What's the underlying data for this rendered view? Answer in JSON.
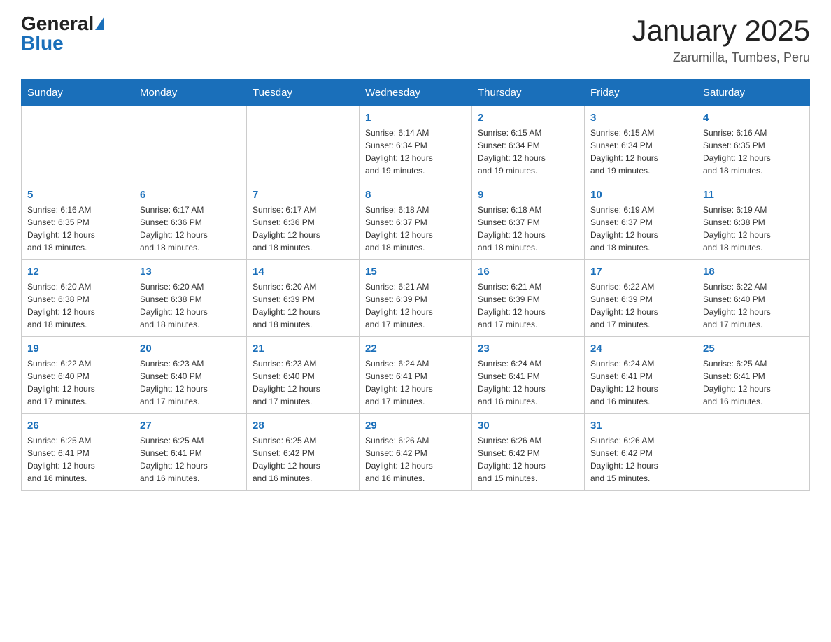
{
  "header": {
    "logo_text_general": "General",
    "logo_text_blue": "Blue",
    "title": "January 2025",
    "subtitle": "Zarumilla, Tumbes, Peru"
  },
  "days_of_week": [
    "Sunday",
    "Monday",
    "Tuesday",
    "Wednesday",
    "Thursday",
    "Friday",
    "Saturday"
  ],
  "weeks": [
    [
      {
        "day": "",
        "info": ""
      },
      {
        "day": "",
        "info": ""
      },
      {
        "day": "",
        "info": ""
      },
      {
        "day": "1",
        "info": "Sunrise: 6:14 AM\nSunset: 6:34 PM\nDaylight: 12 hours\nand 19 minutes."
      },
      {
        "day": "2",
        "info": "Sunrise: 6:15 AM\nSunset: 6:34 PM\nDaylight: 12 hours\nand 19 minutes."
      },
      {
        "day": "3",
        "info": "Sunrise: 6:15 AM\nSunset: 6:34 PM\nDaylight: 12 hours\nand 19 minutes."
      },
      {
        "day": "4",
        "info": "Sunrise: 6:16 AM\nSunset: 6:35 PM\nDaylight: 12 hours\nand 18 minutes."
      }
    ],
    [
      {
        "day": "5",
        "info": "Sunrise: 6:16 AM\nSunset: 6:35 PM\nDaylight: 12 hours\nand 18 minutes."
      },
      {
        "day": "6",
        "info": "Sunrise: 6:17 AM\nSunset: 6:36 PM\nDaylight: 12 hours\nand 18 minutes."
      },
      {
        "day": "7",
        "info": "Sunrise: 6:17 AM\nSunset: 6:36 PM\nDaylight: 12 hours\nand 18 minutes."
      },
      {
        "day": "8",
        "info": "Sunrise: 6:18 AM\nSunset: 6:37 PM\nDaylight: 12 hours\nand 18 minutes."
      },
      {
        "day": "9",
        "info": "Sunrise: 6:18 AM\nSunset: 6:37 PM\nDaylight: 12 hours\nand 18 minutes."
      },
      {
        "day": "10",
        "info": "Sunrise: 6:19 AM\nSunset: 6:37 PM\nDaylight: 12 hours\nand 18 minutes."
      },
      {
        "day": "11",
        "info": "Sunrise: 6:19 AM\nSunset: 6:38 PM\nDaylight: 12 hours\nand 18 minutes."
      }
    ],
    [
      {
        "day": "12",
        "info": "Sunrise: 6:20 AM\nSunset: 6:38 PM\nDaylight: 12 hours\nand 18 minutes."
      },
      {
        "day": "13",
        "info": "Sunrise: 6:20 AM\nSunset: 6:38 PM\nDaylight: 12 hours\nand 18 minutes."
      },
      {
        "day": "14",
        "info": "Sunrise: 6:20 AM\nSunset: 6:39 PM\nDaylight: 12 hours\nand 18 minutes."
      },
      {
        "day": "15",
        "info": "Sunrise: 6:21 AM\nSunset: 6:39 PM\nDaylight: 12 hours\nand 17 minutes."
      },
      {
        "day": "16",
        "info": "Sunrise: 6:21 AM\nSunset: 6:39 PM\nDaylight: 12 hours\nand 17 minutes."
      },
      {
        "day": "17",
        "info": "Sunrise: 6:22 AM\nSunset: 6:39 PM\nDaylight: 12 hours\nand 17 minutes."
      },
      {
        "day": "18",
        "info": "Sunrise: 6:22 AM\nSunset: 6:40 PM\nDaylight: 12 hours\nand 17 minutes."
      }
    ],
    [
      {
        "day": "19",
        "info": "Sunrise: 6:22 AM\nSunset: 6:40 PM\nDaylight: 12 hours\nand 17 minutes."
      },
      {
        "day": "20",
        "info": "Sunrise: 6:23 AM\nSunset: 6:40 PM\nDaylight: 12 hours\nand 17 minutes."
      },
      {
        "day": "21",
        "info": "Sunrise: 6:23 AM\nSunset: 6:40 PM\nDaylight: 12 hours\nand 17 minutes."
      },
      {
        "day": "22",
        "info": "Sunrise: 6:24 AM\nSunset: 6:41 PM\nDaylight: 12 hours\nand 17 minutes."
      },
      {
        "day": "23",
        "info": "Sunrise: 6:24 AM\nSunset: 6:41 PM\nDaylight: 12 hours\nand 16 minutes."
      },
      {
        "day": "24",
        "info": "Sunrise: 6:24 AM\nSunset: 6:41 PM\nDaylight: 12 hours\nand 16 minutes."
      },
      {
        "day": "25",
        "info": "Sunrise: 6:25 AM\nSunset: 6:41 PM\nDaylight: 12 hours\nand 16 minutes."
      }
    ],
    [
      {
        "day": "26",
        "info": "Sunrise: 6:25 AM\nSunset: 6:41 PM\nDaylight: 12 hours\nand 16 minutes."
      },
      {
        "day": "27",
        "info": "Sunrise: 6:25 AM\nSunset: 6:41 PM\nDaylight: 12 hours\nand 16 minutes."
      },
      {
        "day": "28",
        "info": "Sunrise: 6:25 AM\nSunset: 6:42 PM\nDaylight: 12 hours\nand 16 minutes."
      },
      {
        "day": "29",
        "info": "Sunrise: 6:26 AM\nSunset: 6:42 PM\nDaylight: 12 hours\nand 16 minutes."
      },
      {
        "day": "30",
        "info": "Sunrise: 6:26 AM\nSunset: 6:42 PM\nDaylight: 12 hours\nand 15 minutes."
      },
      {
        "day": "31",
        "info": "Sunrise: 6:26 AM\nSunset: 6:42 PM\nDaylight: 12 hours\nand 15 minutes."
      },
      {
        "day": "",
        "info": ""
      }
    ]
  ]
}
